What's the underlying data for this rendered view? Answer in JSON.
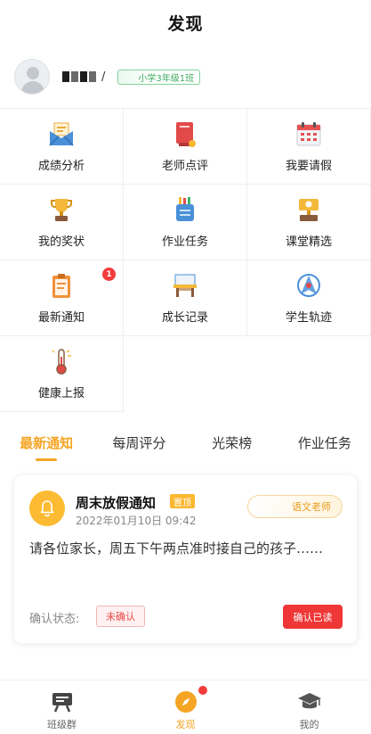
{
  "header": {
    "title": "发现"
  },
  "profile": {
    "name_suffix": "/",
    "class_tag": "小学3年级1班"
  },
  "features": [
    {
      "label": "成绩分析",
      "icon": "envelope-icon"
    },
    {
      "label": "老师点评",
      "icon": "book-icon"
    },
    {
      "label": "我要请假",
      "icon": "calendar-icon"
    },
    {
      "label": "我的奖状",
      "icon": "trophy-icon"
    },
    {
      "label": "作业任务",
      "icon": "pencil-case-icon"
    },
    {
      "label": "课堂精选",
      "icon": "podium-icon"
    },
    {
      "label": "最新通知",
      "icon": "clipboard-icon",
      "badge": "1"
    },
    {
      "label": "成长记录",
      "icon": "desk-icon"
    },
    {
      "label": "学生轨迹",
      "icon": "compass-icon"
    },
    {
      "label": "健康上报",
      "icon": "thermometer-icon"
    }
  ],
  "tabs": [
    {
      "label": "最新通知",
      "active": true
    },
    {
      "label": "每周评分",
      "active": false
    },
    {
      "label": "光荣榜",
      "active": false
    },
    {
      "label": "作业任务",
      "active": false
    }
  ],
  "notice": {
    "title": "周末放假通知",
    "pin_label": "置顶",
    "time": "2022年01月10日 09:42",
    "teacher": "语文老师",
    "body": "请各位家长，周五下午两点准时接自己的孩子……",
    "confirm_status_label": "确认状态:",
    "status": "未确认",
    "confirm_button": "确认已读"
  },
  "bottom_nav": [
    {
      "label": "班级群",
      "icon": "class-group-icon"
    },
    {
      "label": "发现",
      "icon": "discover-compass-icon",
      "active": true
    },
    {
      "label": "我的",
      "icon": "graduation-cap-icon"
    }
  ],
  "colors": {
    "accent": "#f5a524",
    "danger": "#ef3737",
    "green": "#3cab5f"
  }
}
